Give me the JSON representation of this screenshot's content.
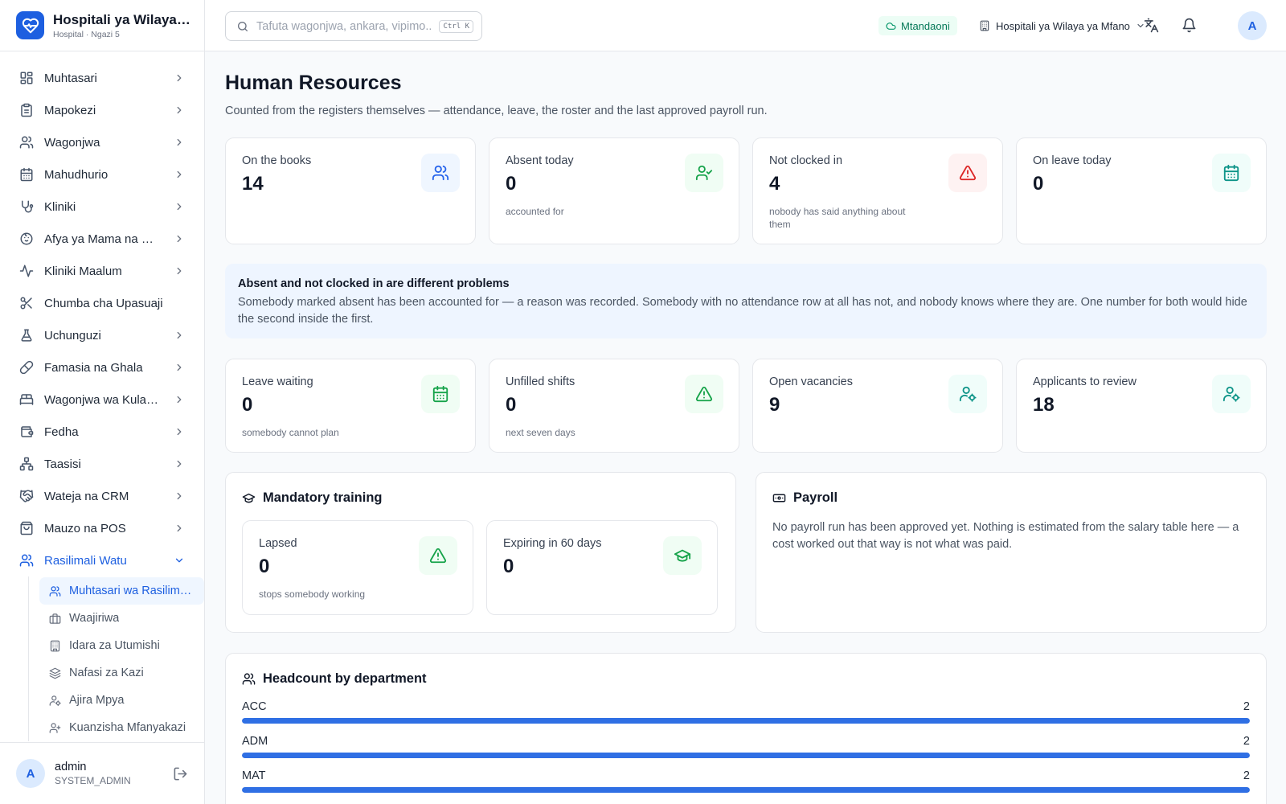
{
  "brand": {
    "name": "Hospitali ya Wilaya ya Mfano",
    "subtitle": "Hospital · Ngazi 5"
  },
  "sidebar": {
    "items": [
      {
        "label": "Muhtasari",
        "icon": "dashboard-icon",
        "chevron": true
      },
      {
        "label": "Mapokezi",
        "icon": "clipboard-icon",
        "chevron": true
      },
      {
        "label": "Wagonjwa",
        "icon": "users-icon",
        "chevron": true
      },
      {
        "label": "Mahudhurio",
        "icon": "calendar-icon",
        "chevron": true
      },
      {
        "label": "Kliniki",
        "icon": "stethoscope-icon",
        "chevron": true
      },
      {
        "label": "Afya ya Mama na Mtoto",
        "icon": "baby-icon",
        "chevron": true
      },
      {
        "label": "Kliniki Maalum",
        "icon": "activity-icon",
        "chevron": true
      },
      {
        "label": "Chumba cha Upasuaji",
        "icon": "scissors-icon",
        "chevron": false
      },
      {
        "label": "Uchunguzi",
        "icon": "flask-icon",
        "chevron": true
      },
      {
        "label": "Famasia na Ghala",
        "icon": "pill-icon",
        "chevron": true
      },
      {
        "label": "Wagonjwa wa Kulazwa",
        "icon": "bed-icon",
        "chevron": true
      },
      {
        "label": "Fedha",
        "icon": "wallet-icon",
        "chevron": true
      },
      {
        "label": "Taasisi",
        "icon": "network-icon",
        "chevron": true
      },
      {
        "label": "Wateja na CRM",
        "icon": "handshake-icon",
        "chevron": true
      },
      {
        "label": "Mauzo na POS",
        "icon": "shopping-bag-icon",
        "chevron": true
      },
      {
        "label": "Rasilimali Watu",
        "icon": "users-icon",
        "chevron": true,
        "active": true
      }
    ],
    "subitems": [
      {
        "label": "Muhtasari wa Rasilimali Watu",
        "icon": "users-icon",
        "active": true
      },
      {
        "label": "Waajiriwa",
        "icon": "briefcase-icon"
      },
      {
        "label": "Idara za Utumishi",
        "icon": "building-icon"
      },
      {
        "label": "Nafasi za Kazi",
        "icon": "layers-icon"
      },
      {
        "label": "Ajira Mpya",
        "icon": "user-gear-icon"
      },
      {
        "label": "Kuanzisha Mfanyakazi",
        "icon": "user-plus-icon"
      }
    ]
  },
  "user": {
    "initial": "A",
    "name": "admin",
    "role": "SYSTEM_ADMIN"
  },
  "topbar": {
    "search_placeholder": "Tafuta wagonjwa, ankara, vipimo...",
    "shortcut": "Ctrl K",
    "status": "Mtandaoni",
    "facility": "Hospitali ya Wilaya ya Mfano",
    "avatar_initial": "A"
  },
  "page": {
    "title": "Human Resources",
    "subtitle": "Counted from the registers themselves — attendance, leave, the roster and the last approved payroll run."
  },
  "stats_top": [
    {
      "label": "On the books",
      "value": "14",
      "note": "",
      "icon": "users-icon",
      "tone": "blue"
    },
    {
      "label": "Absent today",
      "value": "0",
      "note": "accounted for",
      "icon": "user-check-icon",
      "tone": "green"
    },
    {
      "label": "Not clocked in",
      "value": "4",
      "note": "nobody has said anything about them",
      "icon": "alert-triangle-icon",
      "tone": "red"
    },
    {
      "label": "On leave today",
      "value": "0",
      "note": "",
      "icon": "calendar-icon",
      "tone": "teal"
    }
  ],
  "info": {
    "title": "Absent and not clocked in are different problems",
    "text": "Somebody marked absent has been accounted for — a reason was recorded. Somebody with no attendance row at all has not, and nobody knows where they are. One number for both would hide the second inside the first."
  },
  "stats_mid": [
    {
      "label": "Leave waiting",
      "value": "0",
      "note": "somebody cannot plan",
      "icon": "calendar-icon",
      "tone": "green"
    },
    {
      "label": "Unfilled shifts",
      "value": "0",
      "note": "next seven days",
      "icon": "alert-triangle-icon",
      "tone": "green"
    },
    {
      "label": "Open vacancies",
      "value": "9",
      "note": "",
      "icon": "user-gear-icon",
      "tone": "teal"
    },
    {
      "label": "Applicants to review",
      "value": "18",
      "note": "",
      "icon": "user-gear-icon",
      "tone": "teal"
    }
  ],
  "training": {
    "title": "Mandatory training",
    "cards": [
      {
        "label": "Lapsed",
        "value": "0",
        "note": "stops somebody working",
        "icon": "alert-triangle-icon",
        "tone": "green"
      },
      {
        "label": "Expiring in 60 days",
        "value": "0",
        "note": "",
        "icon": "graduation-cap-icon",
        "tone": "green"
      }
    ]
  },
  "payroll": {
    "title": "Payroll",
    "text": "No payroll run has been approved yet. Nothing is estimated from the salary table here — a cost worked out that way is not what was paid."
  },
  "headcount": {
    "title": "Headcount by department",
    "max": 2,
    "rows": [
      {
        "dept": "ACC",
        "count": 2
      },
      {
        "dept": "ADM",
        "count": 2
      },
      {
        "dept": "MAT",
        "count": 2
      }
    ]
  },
  "colors": {
    "accent": "#1d5fe0",
    "bar": "#2f6fe4",
    "info_bg": "#eef5ff"
  }
}
